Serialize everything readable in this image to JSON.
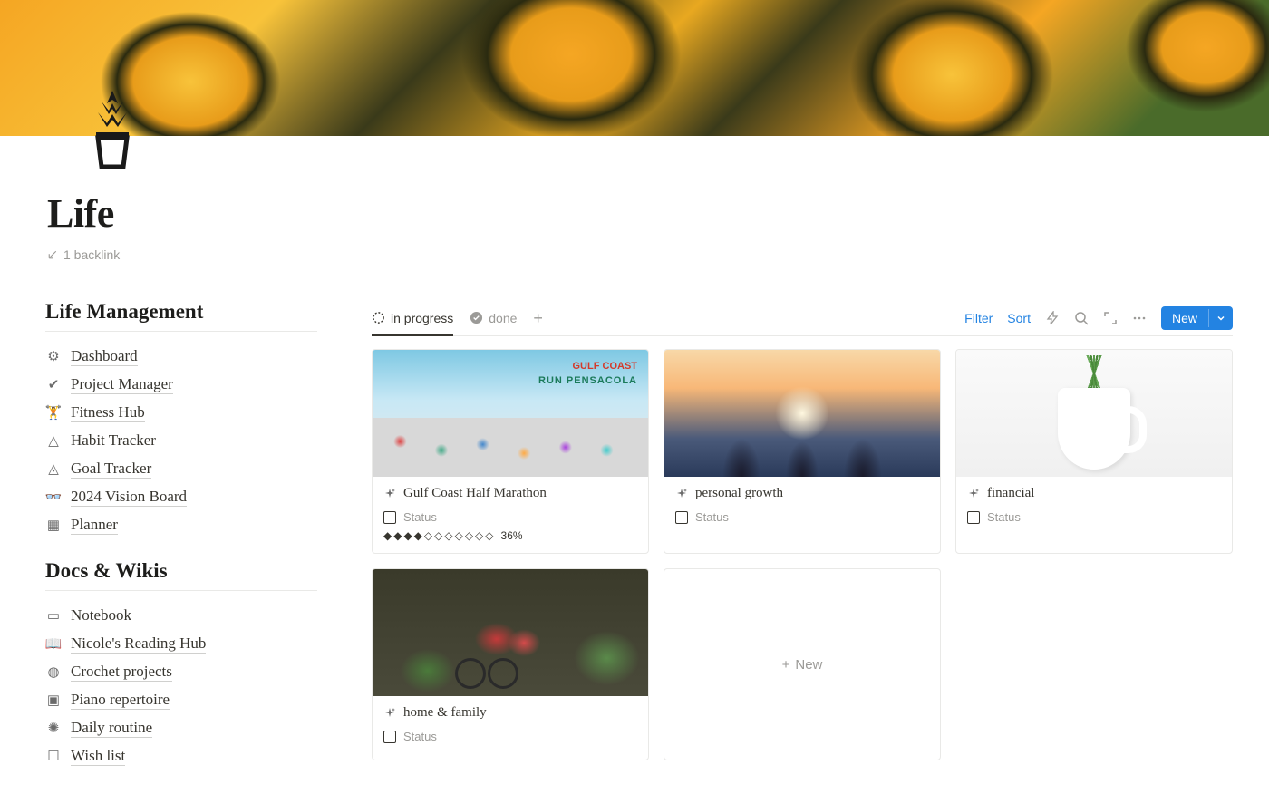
{
  "page": {
    "title": "Life",
    "backlink_count": "1 backlink"
  },
  "sidebar": {
    "sections": [
      {
        "title": "Life Management",
        "items": [
          {
            "icon": "⚙",
            "label": "Dashboard"
          },
          {
            "icon": "✔",
            "label": "Project Manager"
          },
          {
            "icon": "🏋",
            "label": "Fitness Hub"
          },
          {
            "icon": "△",
            "label": "Habit Tracker"
          },
          {
            "icon": "◬",
            "label": "Goal Tracker"
          },
          {
            "icon": "👓",
            "label": "2024 Vision Board"
          },
          {
            "icon": "▦",
            "label": "Planner"
          }
        ]
      },
      {
        "title": "Docs & Wikis",
        "items": [
          {
            "icon": "▭",
            "label": "Notebook"
          },
          {
            "icon": "📖",
            "label": "Nicole's Reading Hub"
          },
          {
            "icon": "◍",
            "label": "Crochet projects"
          },
          {
            "icon": "▣",
            "label": "Piano repertoire"
          },
          {
            "icon": "✺",
            "label": "Daily routine"
          },
          {
            "icon": "☐",
            "label": "Wish list"
          }
        ]
      }
    ]
  },
  "database": {
    "tabs": [
      {
        "label": "in progress",
        "active": true
      },
      {
        "label": "done",
        "active": false
      }
    ],
    "controls": {
      "filter": "Filter",
      "sort": "Sort",
      "new": "New"
    },
    "cards": [
      {
        "title": "Gulf Coast Half Marathon",
        "status_label": "Status",
        "progress_bar": "◆◆◆◆◇◇◇◇◇◇◇",
        "progress_pct": "36%",
        "cover": "marathon"
      },
      {
        "title": "personal growth",
        "status_label": "Status",
        "cover": "growth"
      },
      {
        "title": "financial",
        "status_label": "Status",
        "cover": "financial"
      },
      {
        "title": "home & family",
        "status_label": "Status",
        "cover": "home"
      }
    ],
    "new_card_label": "New"
  }
}
